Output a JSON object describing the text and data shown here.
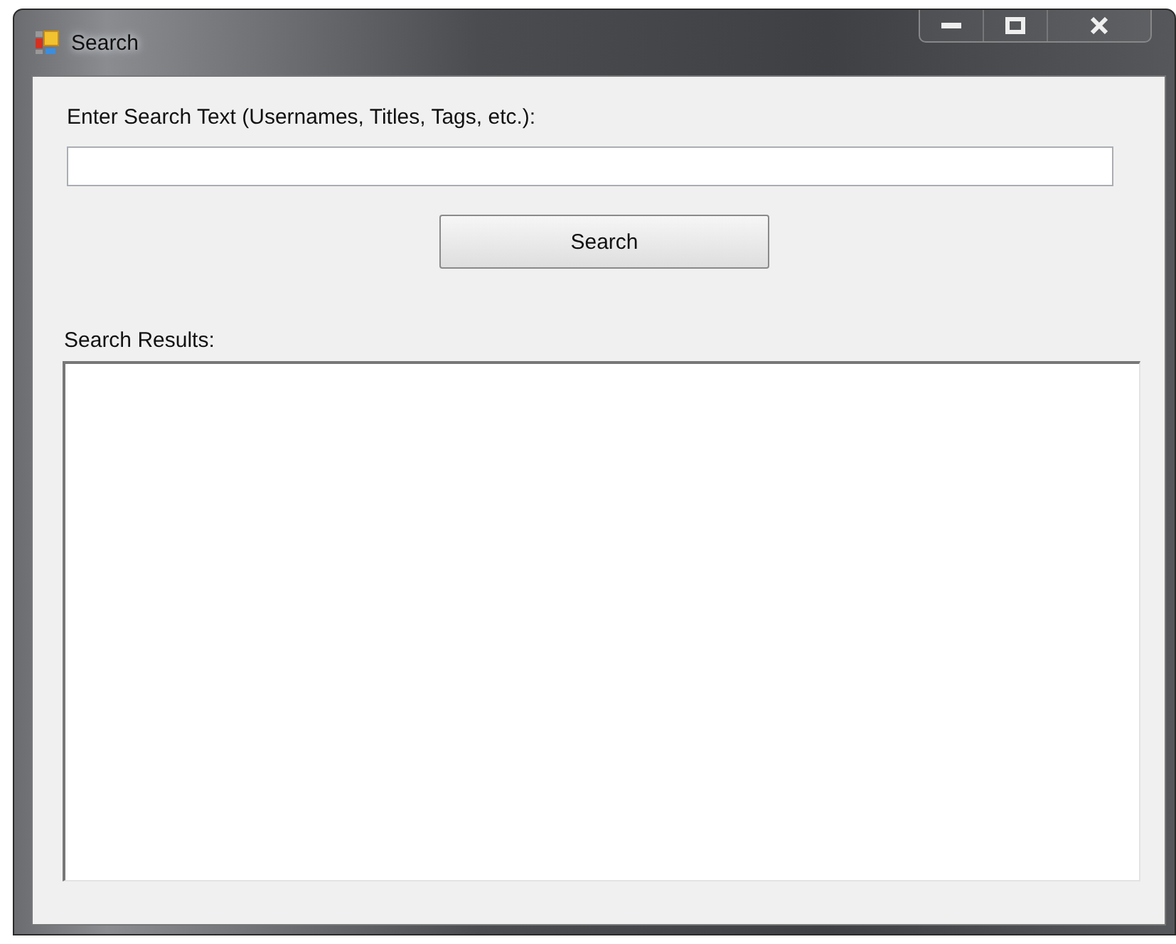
{
  "window": {
    "title": "Search"
  },
  "search_label": "Enter Search Text (Usernames, Titles, Tags, etc.):",
  "search_button": "Search",
  "results_label": "Search Results:"
}
